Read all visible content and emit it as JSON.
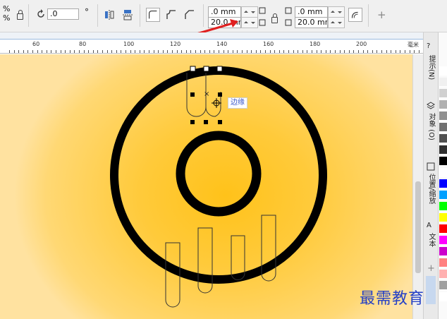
{
  "toolbar": {
    "scale_x": "%",
    "scale_y": "%",
    "rotation_value": ".0",
    "degree_symbol": "°",
    "corner_value_1": ".0 mm",
    "corner_value_2": "20.0 mm",
    "corner_value_3": ".0 mm",
    "corner_value_4": "20.0 mm",
    "add_label": "+"
  },
  "ruler": {
    "ticks": [
      "60",
      "80",
      "100",
      "120",
      "140",
      "160",
      "180",
      "200"
    ],
    "unit": "毫米"
  },
  "canvas": {
    "tooltip": "边缘",
    "center_marker": "×"
  },
  "dockers": {
    "tab_hints": "提示(N)",
    "tab_objects": "对象 (O)",
    "tab_transform": "位置/缩放",
    "tab_text": "文本",
    "add_label": "+"
  },
  "palette": {
    "colors": [
      "#ffffff",
      "#f0f0f0",
      "#d0d0d0",
      "#b0b0b0",
      "#909090",
      "#707070",
      "#505050",
      "#303030",
      "#000000",
      "#ffffff",
      "#0000ff",
      "#00a0ff",
      "#00ff00",
      "#ffff00",
      "#ff0000",
      "#ff00ff",
      "#cc00cc",
      "#ff8080",
      "#ffb0b0",
      "#a0a0a0",
      "#ffffff"
    ]
  },
  "watermark": "最需教育"
}
